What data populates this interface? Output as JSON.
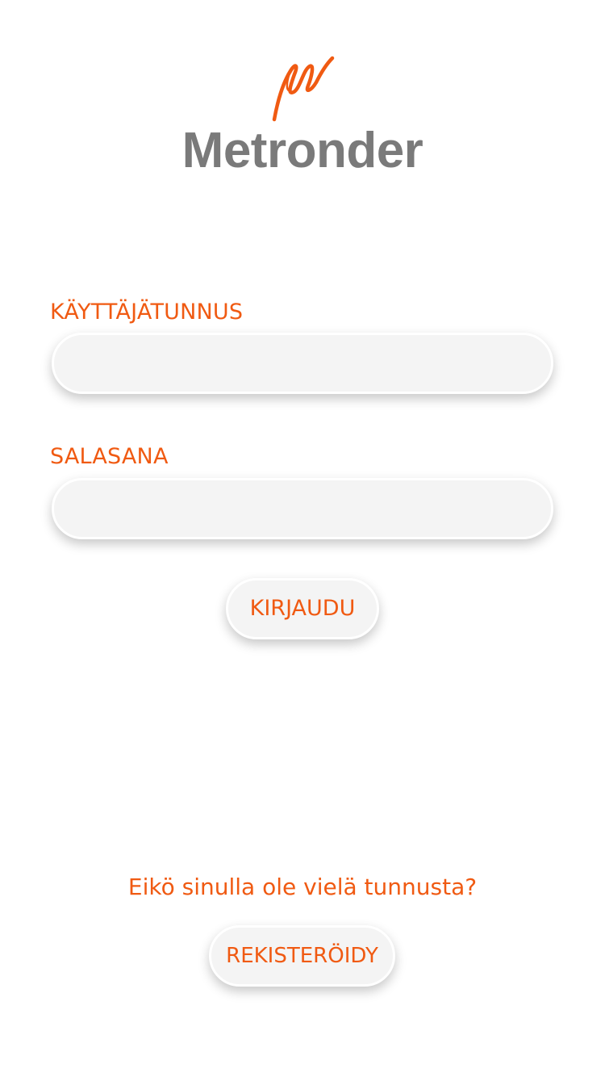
{
  "app": {
    "title": "Metronder",
    "logo_icon": "signature-m-icon",
    "accent_color": "#f05a12",
    "title_color": "#7a7a7a"
  },
  "login_form": {
    "username_label": "KÄYTTÄJÄTUNNUS",
    "username_value": "",
    "password_label": "SALASANA",
    "password_value": "",
    "login_button_label": "KIRJAUDU"
  },
  "register": {
    "prompt": "Eikö sinulla ole vielä tunnusta?",
    "button_label": "REKISTERÖIDY"
  }
}
